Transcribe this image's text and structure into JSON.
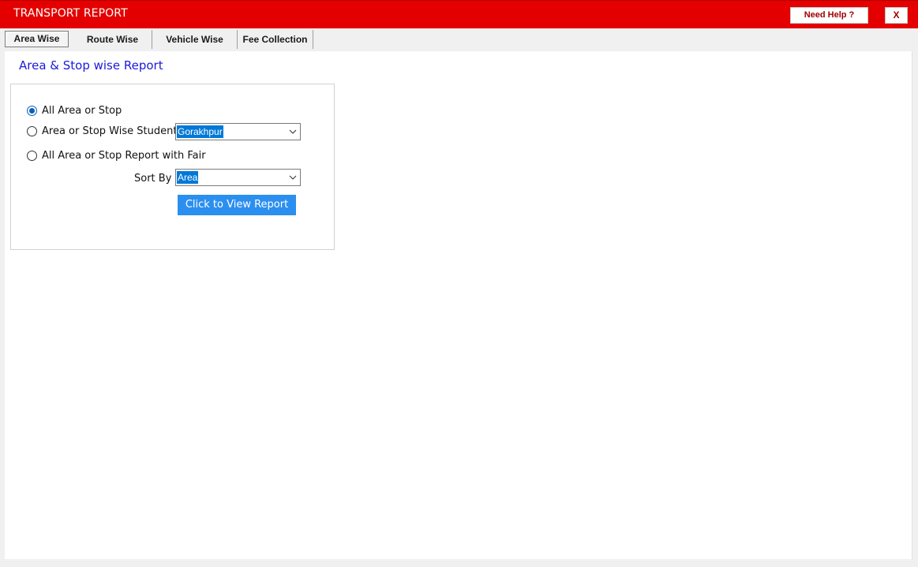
{
  "window": {
    "title": "TRANSPORT REPORT",
    "help_label": "Need Help ?",
    "close_label": "X",
    "accent_color": "#e40000"
  },
  "tabs": [
    {
      "label": "Area Wise",
      "active": true
    },
    {
      "label": "Route Wise",
      "active": false
    },
    {
      "label": "Vehicle Wise",
      "active": false
    },
    {
      "label": "Fee Collection",
      "active": false
    }
  ],
  "report": {
    "heading": "Area & Stop wise Report",
    "options": [
      {
        "label": "All Area or Stop",
        "checked": true
      },
      {
        "label": "Area or Stop Wise Student",
        "checked": false
      },
      {
        "label": "All Area or Stop Report with Fair",
        "checked": false
      }
    ],
    "area_select": {
      "value": "Gorakhpur",
      "icon": "chevron-down-icon"
    },
    "sort_by": {
      "label": "Sort By",
      "value": "Area",
      "icon": "chevron-down-icon"
    },
    "view_button_label": "Click to View Report",
    "button_color": "#2b8ff0",
    "heading_color": "#1a1adc"
  }
}
